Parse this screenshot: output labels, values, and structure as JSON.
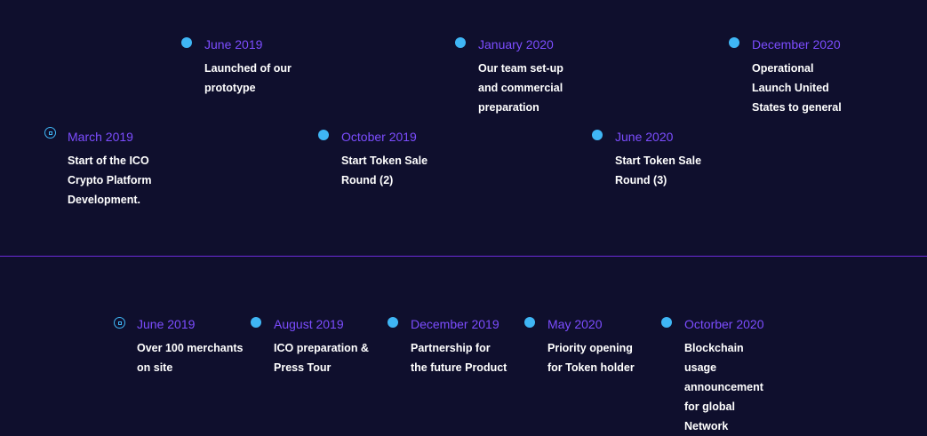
{
  "colors": {
    "background": "#0f0f2d",
    "accent": "#7c4dff",
    "marker": "#3fb6f5",
    "text": "#ffffff",
    "divider": "#6c2bd9"
  },
  "timeline_top": [
    {
      "date": "June 2019",
      "text": "Launched of our prototype",
      "marker_icon": "dot-icon"
    },
    {
      "date": "January 2020",
      "text": "Our team set-up and commercial preparation",
      "marker_icon": "dot-icon"
    },
    {
      "date": "December 2020",
      "text": "Operational Launch United States to general",
      "marker_icon": "dot-icon"
    },
    {
      "date": "March 2019",
      "text": "Start of the ICO Crypto Platform Development.",
      "marker_icon": "ring-icon"
    },
    {
      "date": "October 2019",
      "text": "Start Token Sale Round (2)",
      "marker_icon": "dot-icon"
    },
    {
      "date": "June 2020",
      "text": "Start Token Sale Round (3)",
      "marker_icon": "dot-icon"
    }
  ],
  "timeline_bottom": [
    {
      "date": "June 2019",
      "text": "Over 100 merchants on site",
      "marker_icon": "ring-icon"
    },
    {
      "date": "August 2019",
      "text": "ICO preparation & Press Tour",
      "marker_icon": "dot-icon"
    },
    {
      "date": "December 2019",
      "text": "Partnership for the future Product",
      "marker_icon": "dot-icon"
    },
    {
      "date": "May 2020",
      "text": "Priority opening for Token holder",
      "marker_icon": "dot-icon"
    },
    {
      "date": "Octorber 2020",
      "text": "Blockchain usage announcement for global Network",
      "marker_icon": "dot-icon"
    }
  ]
}
